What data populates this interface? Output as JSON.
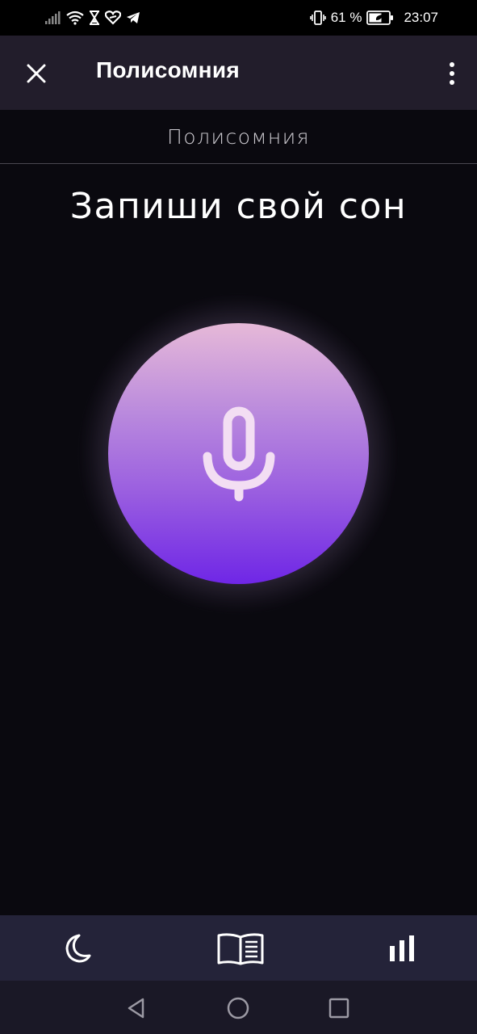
{
  "status_bar": {
    "battery_percent": "61 %",
    "time": "23:07",
    "icons": [
      "signal-icon",
      "wifi-icon",
      "hourglass-icon",
      "heart-icon",
      "telegram-icon",
      "vibrate-icon",
      "battery-icon"
    ]
  },
  "app_bar": {
    "title": "Полисомния"
  },
  "page": {
    "header": "Полисомния",
    "headline": "Запиши свой сон"
  },
  "colors": {
    "background": "#0a090f",
    "app_bar": "#221d2b",
    "bottom_nav": "#242339",
    "mic_top": "#e6b9d8",
    "mic_bottom": "#6f26e6"
  },
  "bottom_nav": {
    "items": [
      {
        "icon": "moon-icon"
      },
      {
        "icon": "book-icon"
      },
      {
        "icon": "bar-chart-icon"
      }
    ]
  },
  "system_nav": {
    "items": [
      {
        "icon": "back-icon"
      },
      {
        "icon": "home-icon"
      },
      {
        "icon": "recents-icon"
      }
    ]
  }
}
